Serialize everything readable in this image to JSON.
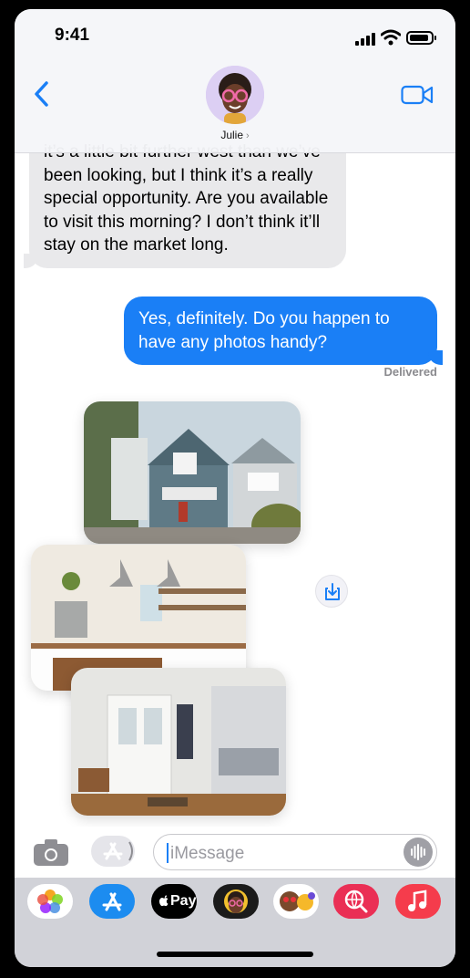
{
  "status": {
    "time": "9:41"
  },
  "header": {
    "contact_name": "Julie",
    "chevron": "›"
  },
  "messages": {
    "incoming": "it’s a little bit further west than we’ve been looking, but I think it’s a really special opportunity. Are you available to visit this morning? I don’t think it’ll stay on the market long.",
    "outgoing": "Yes, definitely. Do you happen to have any photos handy?",
    "delivered": "Delivered"
  },
  "photos": [
    "house-exterior-photo",
    "kitchen-photo",
    "entryway-photo"
  ],
  "input": {
    "placeholder": "iMessage"
  },
  "app_drawer": {
    "apple_pay_label": "Pay"
  },
  "colors": {
    "accent": "#1a7ff6",
    "incoming_bubble": "#e9e9eb"
  }
}
